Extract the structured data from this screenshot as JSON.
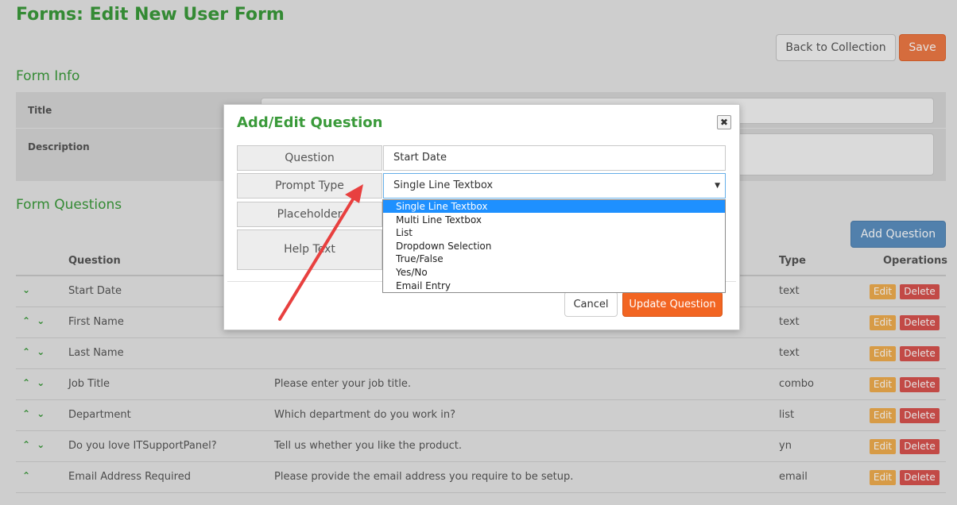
{
  "page": {
    "title": "Forms: Edit New User Form"
  },
  "toolbar": {
    "back_label": "Back to Collection",
    "save_label": "Save"
  },
  "form_info": {
    "section_title": "Form Info",
    "title_label": "Title",
    "description_label": "Description"
  },
  "questions": {
    "section_title": "Form Questions",
    "add_label": "Add Question",
    "headers": {
      "question": "Question",
      "type": "Type",
      "operations": "Operations"
    },
    "edit_label": "Edit",
    "delete_label": "Delete",
    "rows": [
      {
        "arrows": "⌄",
        "question": "Start Date",
        "help": "",
        "type": "text"
      },
      {
        "arrows": "⌃ ⌄",
        "question": "First Name",
        "help": "",
        "type": "text"
      },
      {
        "arrows": "⌃ ⌄",
        "question": "Last Name",
        "help": "",
        "type": "text"
      },
      {
        "arrows": "⌃ ⌄",
        "question": "Job Title",
        "help": "Please enter your job title.",
        "type": "combo"
      },
      {
        "arrows": "⌃ ⌄",
        "question": "Department",
        "help": "Which department do you work in?",
        "type": "list"
      },
      {
        "arrows": "⌃ ⌄",
        "question": "Do you love ITSupportPanel?",
        "help": "Tell us whether you like the product.",
        "type": "yn"
      },
      {
        "arrows": "⌃",
        "question": "Email Address Required",
        "help": "Please provide the email address you require to be setup.",
        "type": "email"
      }
    ]
  },
  "modal": {
    "title": "Add/Edit Question",
    "close_glyph": "✖",
    "question_label": "Question",
    "question_value": "Start Date",
    "prompt_type_label": "Prompt Type",
    "prompt_type_value": "Single Line Textbox",
    "placeholder_label": "Placeholder",
    "help_text_label": "Help Text",
    "cancel_label": "Cancel",
    "update_label": "Update Question",
    "caret": "▼"
  },
  "dropdown": {
    "options": [
      "Single Line Textbox",
      "Multi Line Textbox",
      "List",
      "Dropdown Selection",
      "True/False",
      "Yes/No",
      "Email Entry"
    ],
    "selected_index": 0
  },
  "colors": {
    "accent_green": "#3a9a3a",
    "save_orange": "#ee7944",
    "update_orange": "#f26522",
    "add_blue": "#5b8fc0",
    "edit_yellow": "#f0ad4e",
    "delete_red": "#d9534f",
    "annotation_red": "#e8403f"
  },
  "icons": {
    "annotation": "red-arrow-icon",
    "sort": "chevron-icon"
  }
}
